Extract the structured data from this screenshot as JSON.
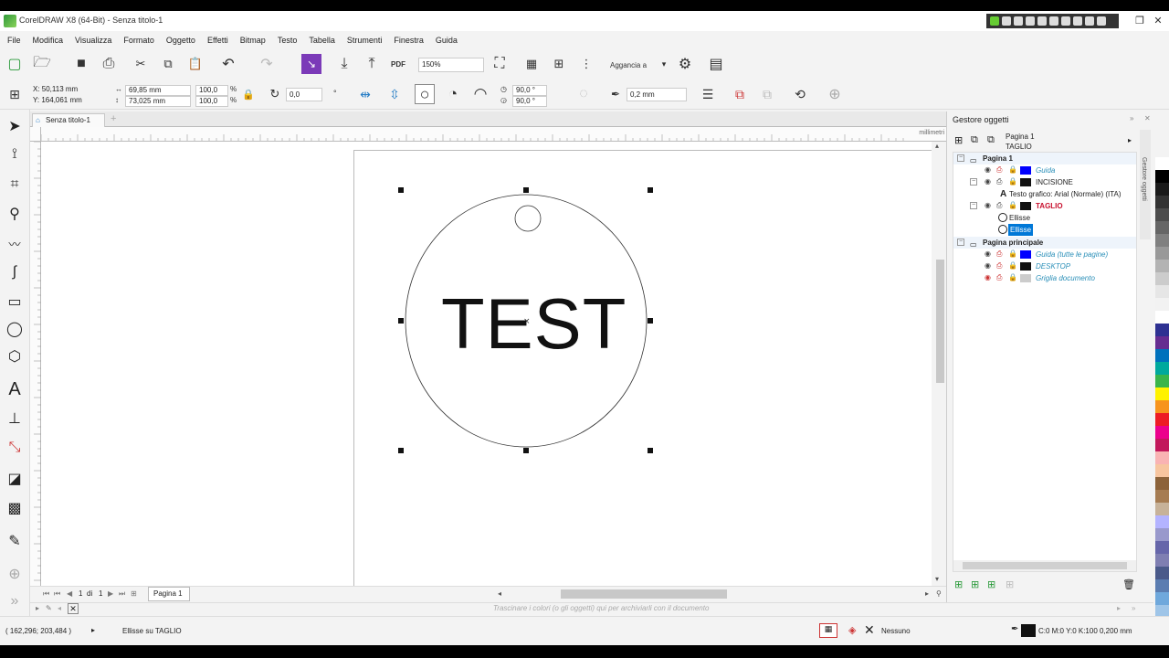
{
  "window": {
    "title": "CorelDRAW X8 (64-Bit) - Senza titolo-1"
  },
  "menu": [
    "File",
    "Modifica",
    "Visualizza",
    "Formato",
    "Oggetto",
    "Effetti",
    "Bitmap",
    "Testo",
    "Tabella",
    "Strumenti",
    "Finestra",
    "Guida"
  ],
  "toolbar": {
    "zoom": "150%",
    "snap_label": "Aggancia a",
    "pdf_label": "PDF"
  },
  "props": {
    "x": "X: 50,113 mm",
    "y": "Y: 164,061 mm",
    "w": "69,85 mm",
    "h": "73,025 mm",
    "sx": "100,0",
    "sy": "100,0",
    "pct1": "%",
    "pct2": "%",
    "rotation": "0,0",
    "angle1": "90,0 °",
    "angle2": "90,0 °",
    "outline": "0,2 mm"
  },
  "document": {
    "tab": "Senza titolo-1",
    "canvas_text": "TEST",
    "page_tab": "Pagina 1",
    "page_nav_current": "1",
    "page_nav_of": "di",
    "page_nav_total": "1"
  },
  "ruler_units": "millimetri",
  "docker": {
    "title": "Gestore oggetti",
    "header_page": "Pagina 1",
    "header_layer": "TAGLIO",
    "side_tab": "Gestore oggetti",
    "tree": [
      {
        "label": "Pagina 1",
        "bold": true
      },
      {
        "label": "Guida",
        "italic": true,
        "color": "#0000ff"
      },
      {
        "label": "INCISIONE",
        "color": "#111111"
      },
      {
        "label": "Testo grafico: Arial (Normale) (ITA)"
      },
      {
        "label": "TAGLIO",
        "bold": true,
        "red": true,
        "color": "#111111"
      },
      {
        "label": "Ellisse"
      },
      {
        "label": "Ellisse",
        "selected": true
      },
      {
        "label": "Pagina principale",
        "bold": true
      },
      {
        "label": "Guida (tutte le pagine)",
        "italic": true,
        "color": "#0000ff"
      },
      {
        "label": "DESKTOP",
        "italic": true,
        "color": "#111111"
      },
      {
        "label": "Griglia documento",
        "italic": true,
        "color": "#cccccc"
      }
    ]
  },
  "palette_hint": "Trascinare i colori (o gli oggetti) qui per archiviarli con il documento",
  "status": {
    "coords": "( 162,296; 203,484 )",
    "selection": "Ellisse su TAGLIO",
    "fill": "Nessuno",
    "outline_info": "C:0 M:0 Y:0 K:100  0,200 mm"
  },
  "colors": {
    "selection": "#0078d7",
    "accent": "#2a8fb8"
  }
}
